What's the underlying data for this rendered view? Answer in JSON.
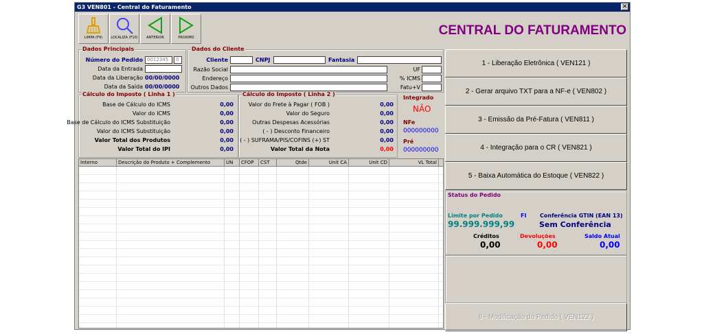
{
  "window": {
    "title": "G3 VEN801 - Central do Faturamento",
    "close": "✕"
  },
  "toolbar": [
    {
      "label": "LIMPA (F9)",
      "icon": "broom-icon"
    },
    {
      "label": "LOCALIZA (F10)",
      "icon": "search-icon"
    },
    {
      "label": "ANTERIOR",
      "icon": "arrow-left-icon"
    },
    {
      "label": "PROXIMO",
      "icon": "arrow-right-icon"
    }
  ],
  "page_title": "CENTRAL DO FATURAMENTO",
  "dados_principais": {
    "title": "Dados Principais",
    "numero_label": "Número do Pedido",
    "numero_value": "0012345",
    "numero_seq": "0",
    "entrada_label": "Data da Entrada",
    "entrada_value": "",
    "liberacao_label": "Data da Liberação",
    "liberacao_value": "00/00/0000",
    "saida_label": "Data da Saída",
    "saida_value": "00/00/0000"
  },
  "dados_cliente": {
    "title": "Dados do Cliente",
    "cliente": "Cliente",
    "cnpj": "CNPJ",
    "fantasia": "Fantasia",
    "razao": "Razão Social",
    "endereco": "Endereço",
    "outros": "Outros Dados",
    "uf": "UF",
    "icms": "% ICMS",
    "fatu": "Fatu+V"
  },
  "calc1": {
    "title": "Cálculo do Imposto ( Linha 1 )",
    "rows": [
      {
        "label": "Base de Cálculo do ICMS",
        "value": "0,00"
      },
      {
        "label": "Valor do ICMS",
        "value": "0,00"
      },
      {
        "label": "Base de Cálculo do ICMS Substituição",
        "value": "0,00"
      },
      {
        "label": "Valor do ICMS Substituição",
        "value": "0,00"
      },
      {
        "label": "Valor Total dos Produtos",
        "value": "0,00"
      },
      {
        "label": "Valor Total do IPI",
        "value": "0,00"
      }
    ]
  },
  "calc2": {
    "title": "Cálculo do Imposto ( Linha 2 )",
    "rows": [
      {
        "label": "Valor do Frete à Pagar ( FOB )",
        "value": "0,00"
      },
      {
        "label": "Valor do Seguro",
        "value": "0,00"
      },
      {
        "label": "Outras Despesas Acessórias",
        "value": "0,00"
      },
      {
        "label": "( - ) Desconto Financeiro",
        "value": "0,00"
      },
      {
        "label": "( - ) SUFRAMA/PIS/COFINS (+) ST",
        "value": "0,00"
      },
      {
        "label": "Valor Total da Nota",
        "value": "0,00"
      }
    ]
  },
  "integrado": {
    "title": "Integrado",
    "value": "NÃO",
    "nfe_title": "NFe",
    "nfe_value": "000000000",
    "pre_title": "Pré",
    "pre_value": "000000000"
  },
  "grid": {
    "columns": [
      "Interno",
      "Descrição do Produto + Complemento",
      "UN",
      "CFOP",
      "CST",
      "Qtde",
      "Unit CA",
      "Unit CD",
      "VL Total"
    ]
  },
  "actions": [
    "1 - Liberação Eletrônica ( VEN121 )",
    "2 - Gerar arquivo TXT para a NF-e ( VEN802 )",
    "3 - Emissão da Pré-Fatura ( VEN811 )",
    "4 - Integração para o CR ( VEN821 )",
    "5 - Baixa Automática do Estoque ( VEN822 )"
  ],
  "status": {
    "title": "Status do Pedido",
    "limite_label": "Limite por Pedido",
    "limite_value": "99.999.999,99",
    "fi": "FI",
    "gtin_label": "Conferência GTIN (EAN 13)",
    "gtin_value": "Sem Conferência",
    "creditos_label": "Créditos",
    "creditos_value": "0,00",
    "devolucoes_label": "Devoluções",
    "devolucoes_value": "0,00",
    "saldo_label": "Saldo Atual",
    "saldo_value": "0,00"
  },
  "modificacao": "6 - Modificação do Pedido ( VEN122 )",
  "colors": {
    "titlebar": "#0a246a",
    "title": "#800080",
    "label_blue": "#000080",
    "red": "#ff0000",
    "teal": "#008080"
  }
}
